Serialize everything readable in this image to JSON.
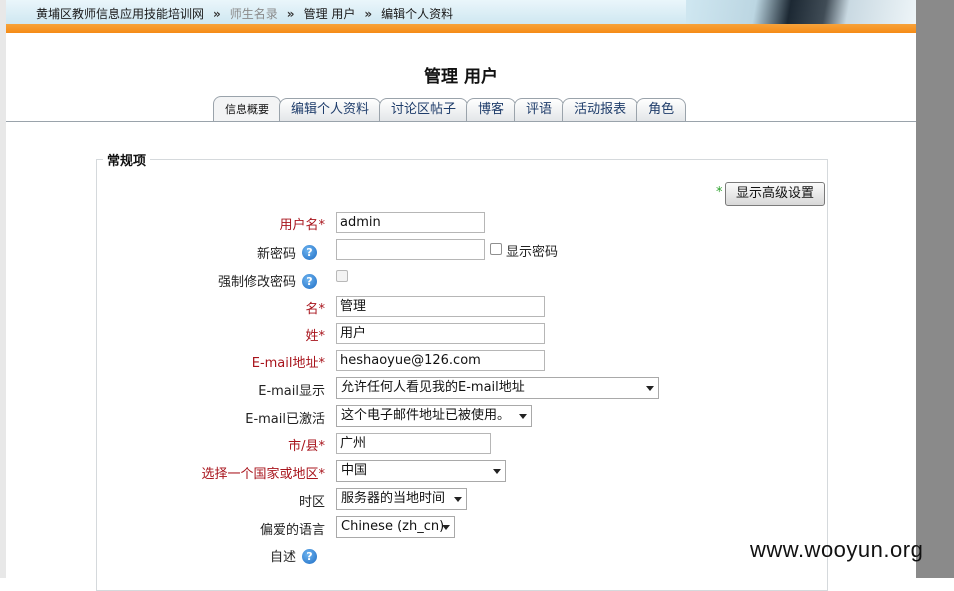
{
  "breadcrumb": {
    "site": "黄埔区教师信息应用技能培训网",
    "sep": "»",
    "item2": "师生名录",
    "item3": "管理 用户",
    "item4": "编辑个人资料"
  },
  "page_title": "管理 用户",
  "tabs": [
    "信息概要",
    "编辑个人资料",
    "讨论区帖子",
    "博客",
    "评语",
    "活动报表",
    "角色"
  ],
  "form": {
    "legend": "常规项",
    "required_mark": "*",
    "advanced_button": "显示高级设置",
    "help_glyph": "?",
    "username": {
      "label": "用户名",
      "value": "admin"
    },
    "new_password": {
      "label": "新密码",
      "value": "",
      "show_label": "显示密码"
    },
    "force_change": {
      "label": "强制修改密码"
    },
    "firstname": {
      "label": "名",
      "value": "管理"
    },
    "lastname": {
      "label": "姓",
      "value": "用户"
    },
    "email": {
      "label": "E-mail地址",
      "value": "heshaoyue@126.com"
    },
    "email_display": {
      "label": "E-mail显示",
      "value": "允许任何人看见我的E-mail地址"
    },
    "email_active": {
      "label": "E-mail已激活",
      "value": "这个电子邮件地址已被使用。"
    },
    "city": {
      "label": "市/县",
      "value": "广州"
    },
    "country": {
      "label": "选择一个国家或地区",
      "value": "中国"
    },
    "timezone": {
      "label": "时区",
      "value": "服务器的当地时间"
    },
    "language": {
      "label": "偏爱的语言",
      "value": "Chinese (zh_cn)"
    },
    "description": {
      "label": "自述"
    }
  },
  "watermark": "www.wooyun.org",
  "colors": {
    "required": "#a8141c",
    "orange_bar": "#f58b16",
    "tab_text": "#1f3d6b"
  }
}
